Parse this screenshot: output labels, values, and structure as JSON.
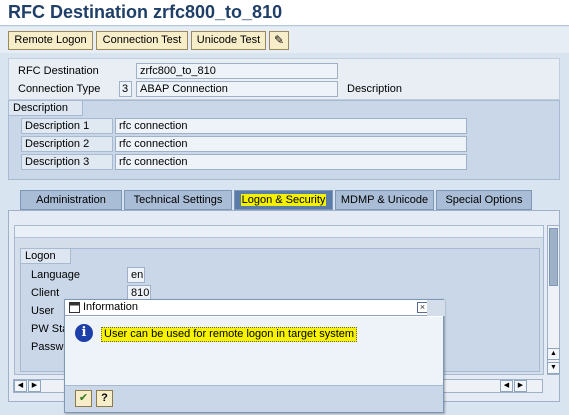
{
  "page": {
    "title": "RFC Destination zrfc800_to_810"
  },
  "toolbar": {
    "remote_logon": "Remote Logon",
    "connection_test": "Connection Test",
    "unicode_test": "Unicode Test",
    "edit_icon": "✎"
  },
  "header": {
    "rfc_destination_label": "RFC Destination",
    "rfc_destination_value": "zrfc800_to_810",
    "connection_type_label": "Connection Type",
    "connection_type_code": "3",
    "connection_type_text": "ABAP Connection",
    "description_label": "Description"
  },
  "description": {
    "group_title": "Description",
    "rows": [
      {
        "label": "Description 1",
        "value": "rfc connection"
      },
      {
        "label": "Description 2",
        "value": "rfc connection"
      },
      {
        "label": "Description 3",
        "value": "rfc connection"
      }
    ]
  },
  "tabs": [
    {
      "label": "Administration"
    },
    {
      "label": "Technical Settings"
    },
    {
      "label": "Logon & Security",
      "active": true
    },
    {
      "label": "MDMP & Unicode"
    },
    {
      "label": "Special Options"
    }
  ],
  "logon": {
    "group_title": "Logon",
    "language_label": "Language",
    "language_value": "en",
    "client_label": "Client",
    "client_value": "810",
    "user_label": "User",
    "pw_status_label": "PW Sta",
    "password_label": "Passw"
  },
  "dialog": {
    "title": "Information",
    "close": "×",
    "message": "User can be used for remote logon in target system",
    "ok": "✔",
    "help": "?"
  },
  "scroll": {
    "up": "▲",
    "down": "▼",
    "left": "◀",
    "right": "▶"
  },
  "colors": {
    "highlight": "#f6f200",
    "title": "#1f3f68",
    "active_tab": "#5b7ca8"
  }
}
